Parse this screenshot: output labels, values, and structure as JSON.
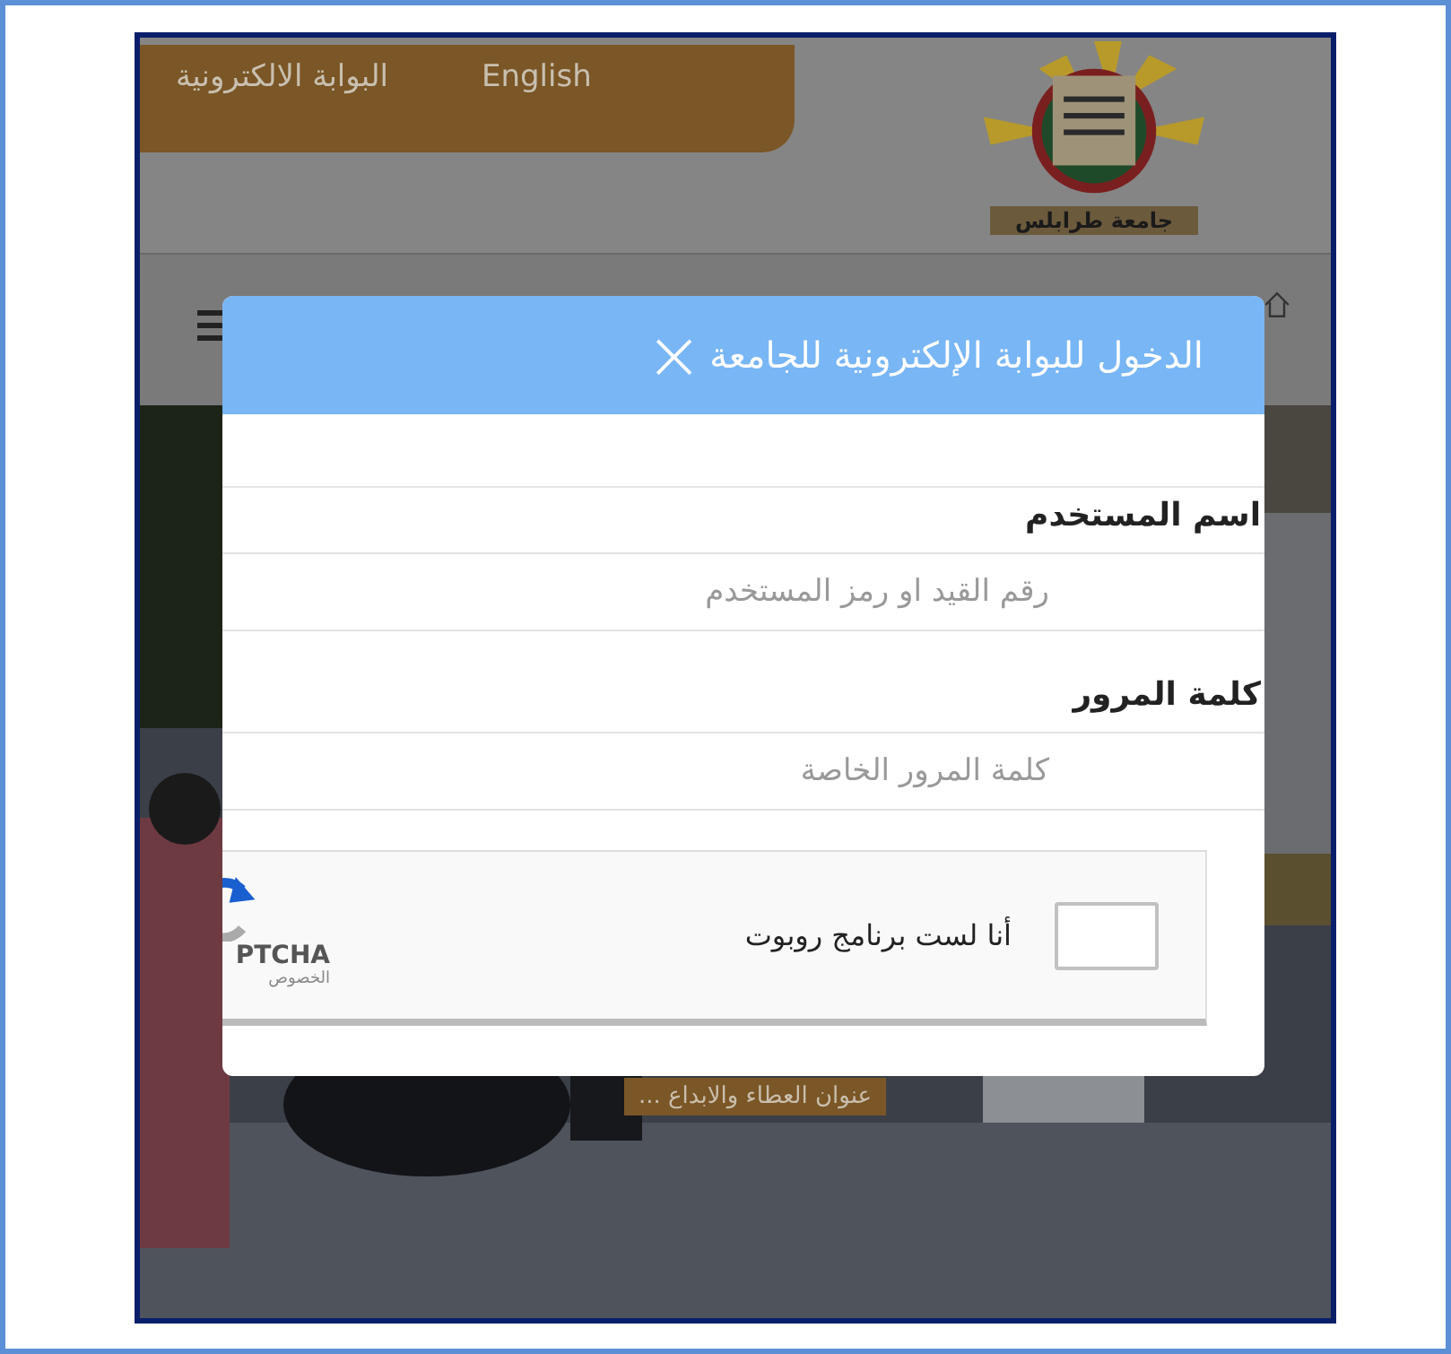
{
  "header": {
    "links": [
      {
        "label": "English"
      },
      {
        "label": "البوابة الالكترونية"
      }
    ],
    "logo_banner": "جامعة طرابلس"
  },
  "caption": "... عنوان العطاء والابداع",
  "dialog": {
    "title": "الدخول للبوابة الإلكترونية للجامعة",
    "close": "×",
    "fields": [
      {
        "label": "اسم المستخدم",
        "placeholder": "رقم القيد او رمز المستخدم"
      },
      {
        "label": "كلمة المرور",
        "placeholder": "كلمة المرور الخاصة"
      }
    ],
    "captcha": {
      "label": "أنا لست برنامج روبوت",
      "checked": false,
      "brand": "PTCHA",
      "privacy": "الخصوص"
    }
  }
}
